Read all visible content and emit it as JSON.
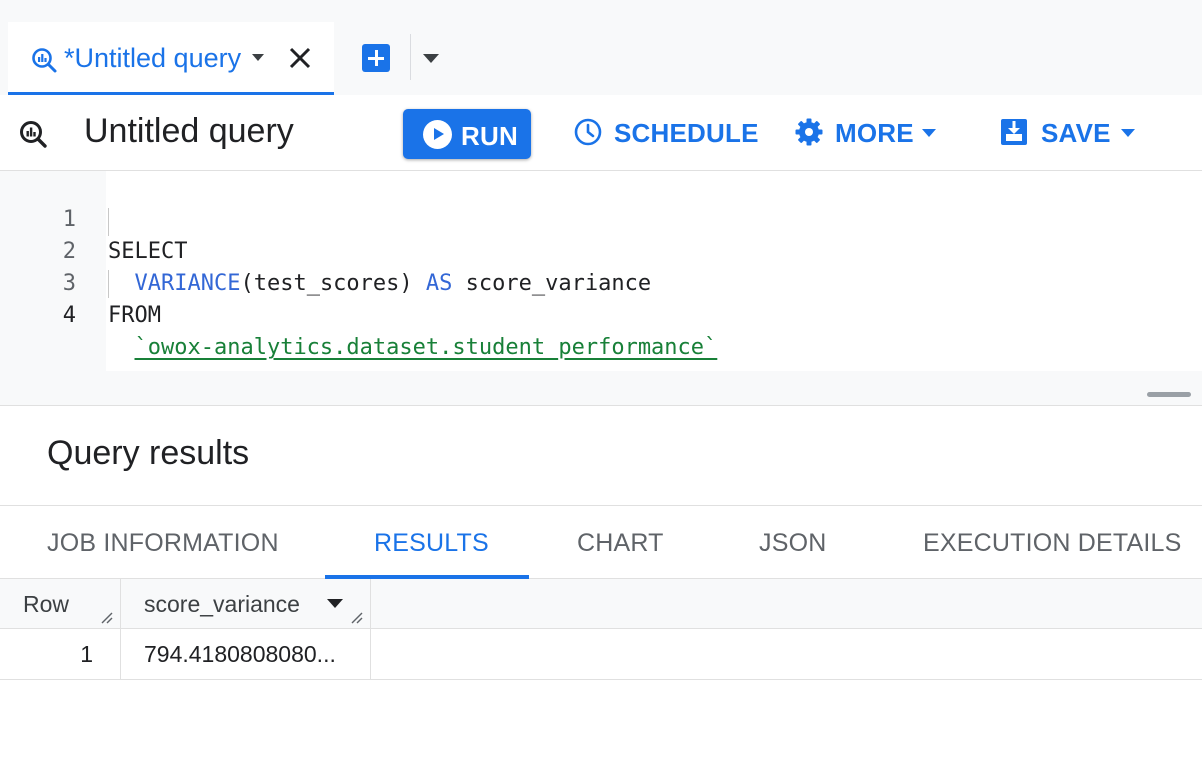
{
  "tab": {
    "title": "*Untitled query"
  },
  "toolbar": {
    "query_title": "Untitled query",
    "run_label": "RUN",
    "schedule_label": "SCHEDULE",
    "more_label": "MORE",
    "save_label": "SAVE"
  },
  "editor": {
    "lines": [
      {
        "num": "1",
        "code": "SELECT"
      },
      {
        "num": "2",
        "code": "  VARIANCE(test_scores) AS score_variance"
      },
      {
        "num": "3",
        "code": "FROM"
      },
      {
        "num": "4",
        "code": "  `owox-analytics.dataset.student_performance`"
      }
    ]
  },
  "results": {
    "title": "Query results",
    "tabs": [
      {
        "label": "JOB INFORMATION"
      },
      {
        "label": "RESULTS"
      },
      {
        "label": "CHART"
      },
      {
        "label": "JSON"
      },
      {
        "label": "EXECUTION DETAILS"
      }
    ],
    "active_tab": "RESULTS",
    "columns": [
      "Row",
      "score_variance"
    ],
    "rows": [
      {
        "row": "1",
        "score_variance": "794.4180808080..."
      }
    ]
  },
  "colors": {
    "accent": "#1a73e8",
    "keyword": "#3367d6",
    "string": "#188038"
  },
  "icons": {
    "tab": "query-icon",
    "close": "close-icon",
    "new_tab": "plus-box-icon",
    "run": "play-circle-icon",
    "schedule": "clock-icon",
    "more": "gear-icon",
    "save": "save-download-icon"
  }
}
